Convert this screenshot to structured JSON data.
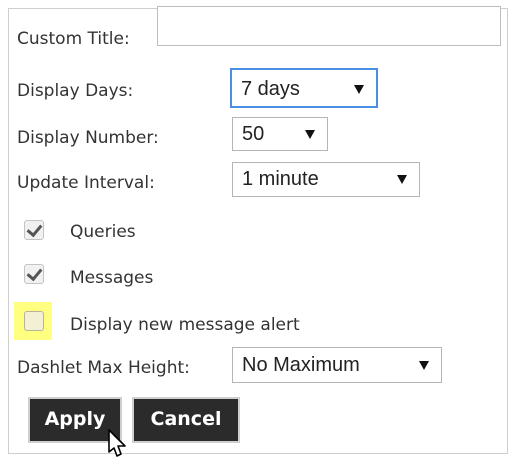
{
  "form": {
    "custom_title": {
      "label": "Custom Title:",
      "value": ""
    },
    "display_days": {
      "label": "Display Days:",
      "value": "7 days"
    },
    "display_number": {
      "label": "Display Number:",
      "value": "50"
    },
    "update_interval": {
      "label": "Update Interval:",
      "value": "1 minute"
    },
    "queries": {
      "label": "Queries",
      "checked": true
    },
    "messages": {
      "label": "Messages",
      "checked": true
    },
    "new_message_alert": {
      "label": "Display new message alert",
      "checked": false,
      "highlight_color": "#ffff80"
    },
    "max_height": {
      "label": "Dashlet Max Height:",
      "value": "No Maximum"
    }
  },
  "buttons": {
    "apply": "Apply",
    "cancel": "Cancel"
  },
  "colors": {
    "button_bg": "#2b2b2b",
    "focus_border": "#4a90e2"
  },
  "icons": {
    "cursor": "pointer-arrow-icon"
  }
}
